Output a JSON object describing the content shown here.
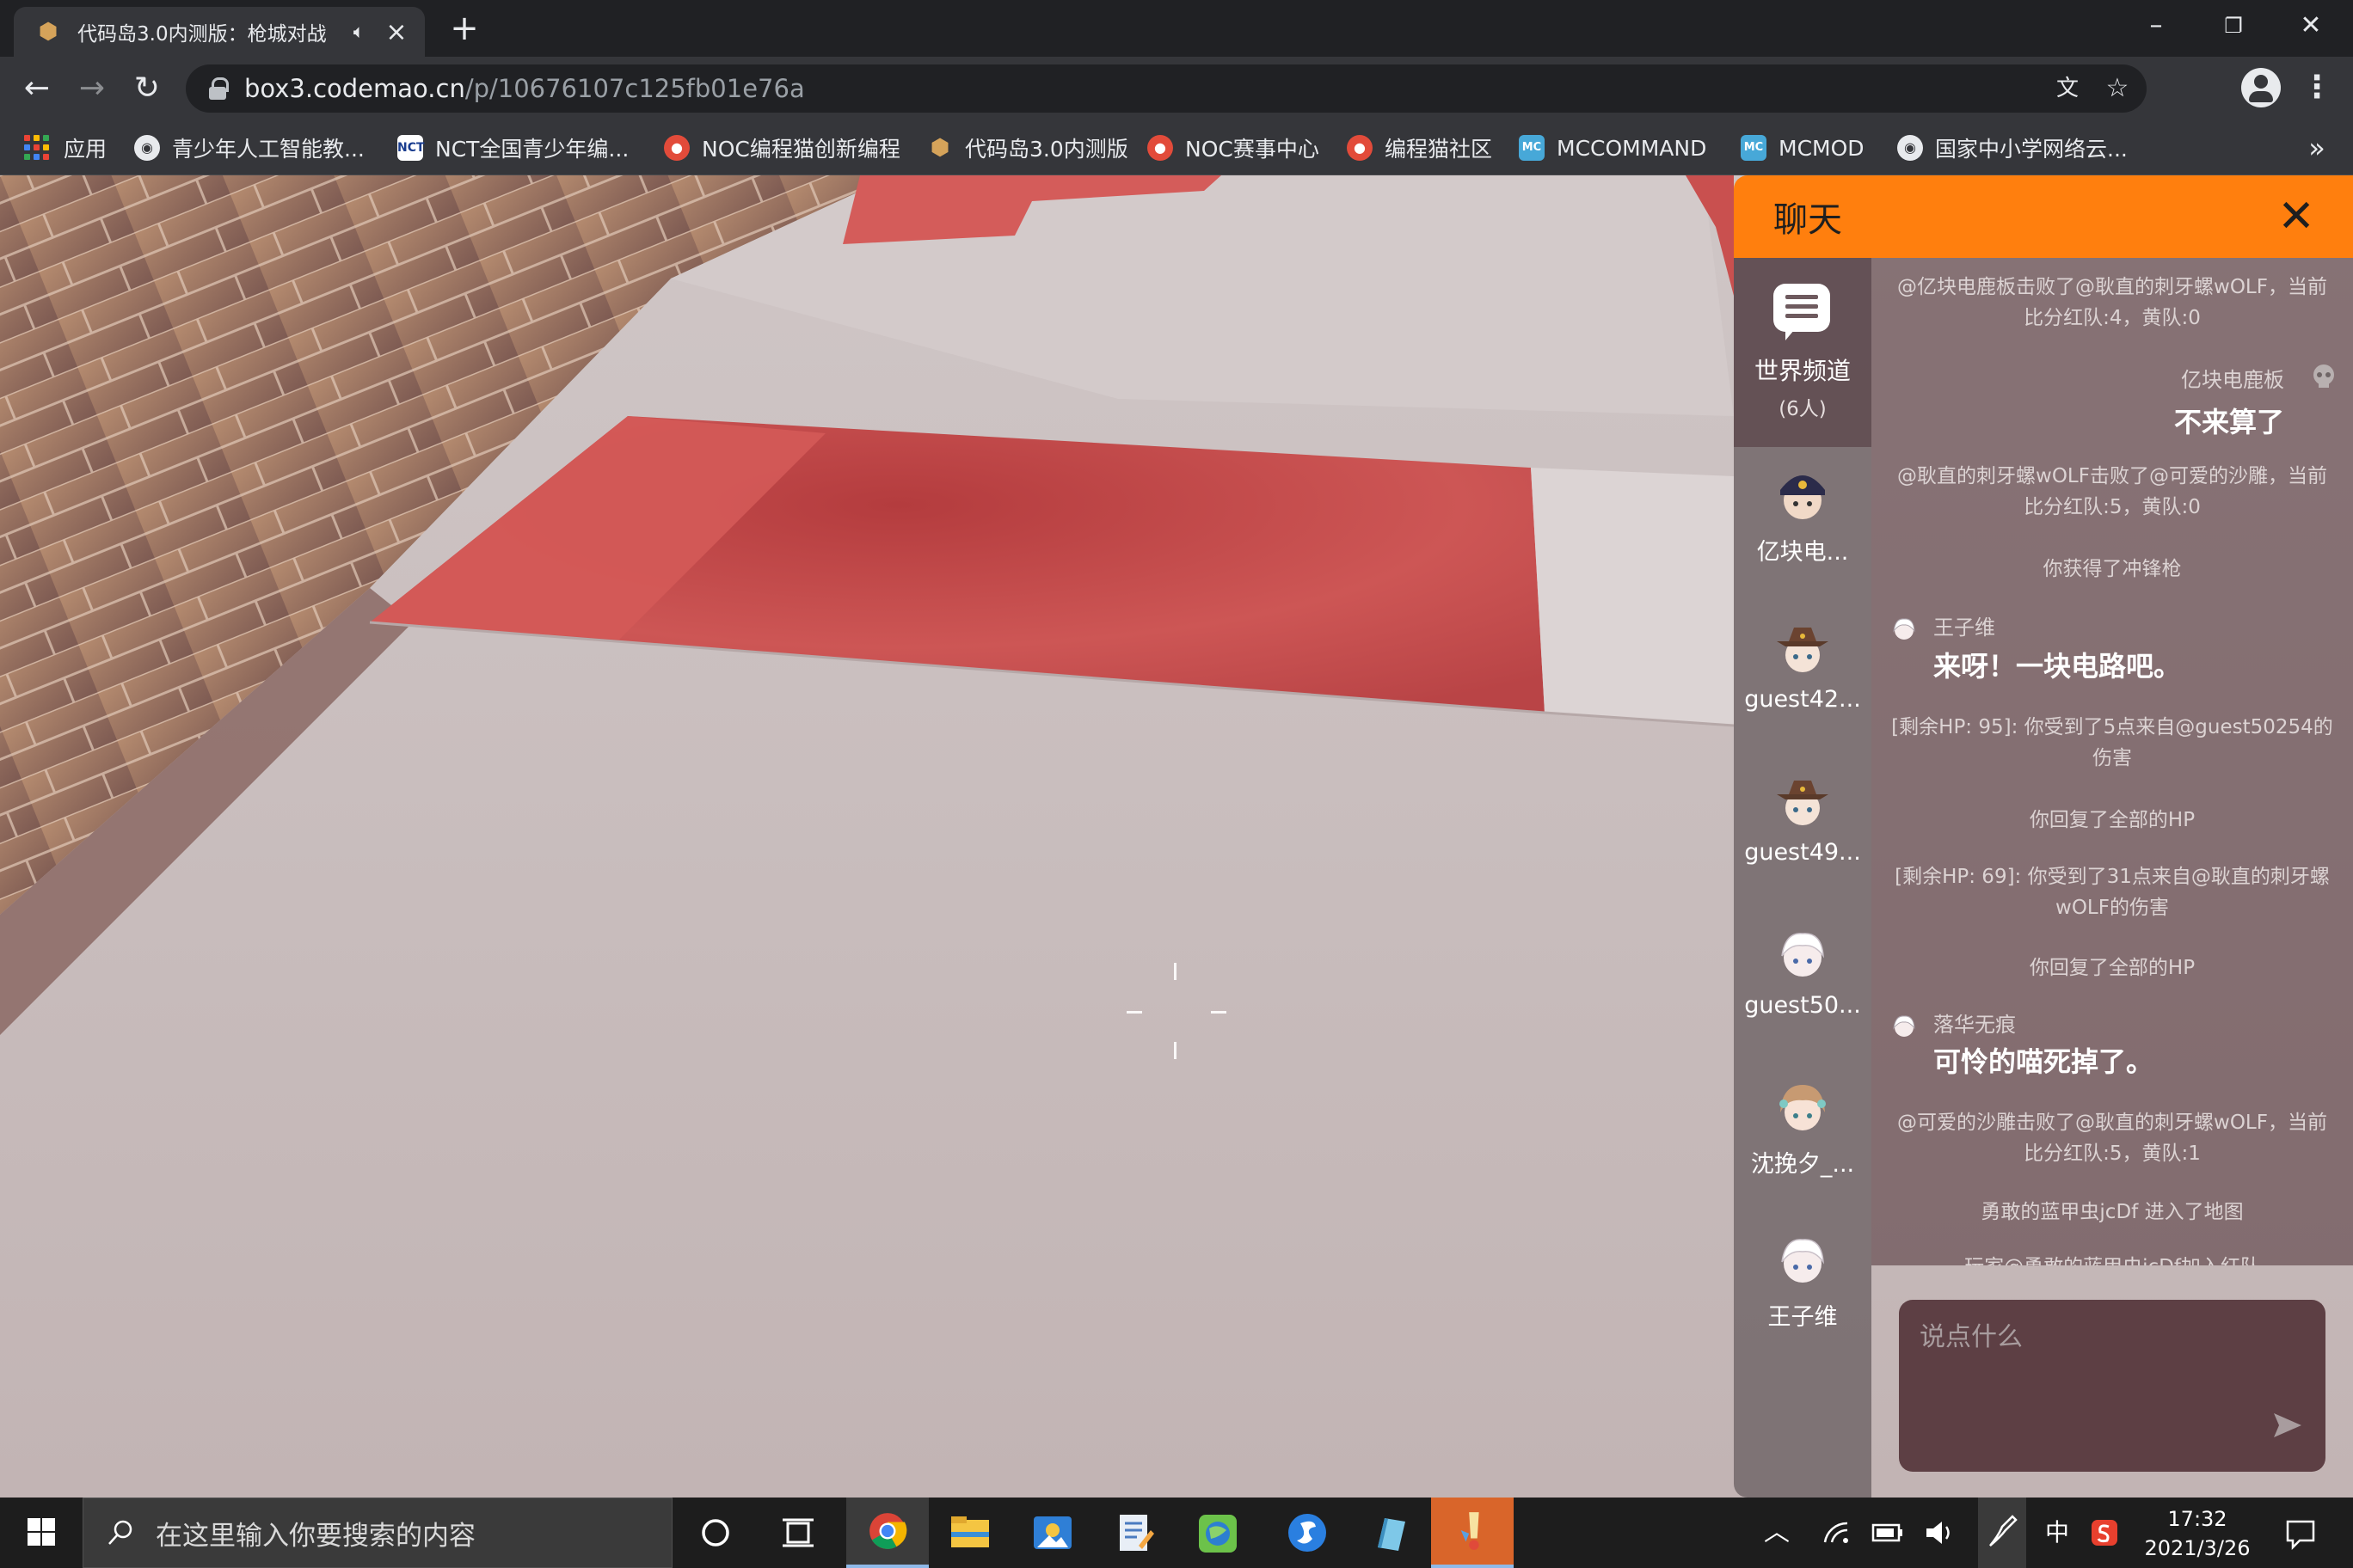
{
  "browser": {
    "tab_title": "代码岛3.0内测版：枪城对战",
    "tab_audio_icon": "speaker-icon",
    "url_host": "box3.codemao.cn",
    "url_path": "/p/10676107c125fb01e76a",
    "bookmarks": [
      {
        "label": "应用",
        "icon": "apps-grid-icon"
      },
      {
        "label": "青少年人工智能教...",
        "icon": "globe-icon"
      },
      {
        "label": "NCT全国青少年编...",
        "icon": "nct-icon"
      },
      {
        "label": "NOC编程猫创新编程",
        "icon": "codemao-icon"
      },
      {
        "label": "代码岛3.0内测版",
        "icon": "box3-icon"
      },
      {
        "label": "NOC赛事中心",
        "icon": "codemao-icon"
      },
      {
        "label": "编程猫社区",
        "icon": "codemao-icon"
      },
      {
        "label": "MCCOMMAND",
        "icon": "mc-icon"
      },
      {
        "label": "MCMOD",
        "icon": "mc-icon"
      },
      {
        "label": "国家中小学网络云...",
        "icon": "globe-icon"
      }
    ],
    "more_bookmarks": "»"
  },
  "chat": {
    "title": "聊天",
    "world_channel": {
      "label": "世界频道",
      "count": "(6人)"
    },
    "members": [
      {
        "name": "亿块电...",
        "avatar": "avatar-hat-dark"
      },
      {
        "name": "guest42...",
        "avatar": "avatar-hat-brown"
      },
      {
        "name": "guest49...",
        "avatar": "avatar-hat-brown"
      },
      {
        "name": "guest50...",
        "avatar": "avatar-white-hair"
      },
      {
        "name": "沈挽夕_...",
        "avatar": "avatar-brown-hair"
      },
      {
        "name": "王子维",
        "avatar": "avatar-white-hair"
      }
    ],
    "messages": {
      "m1": "@亿块电鹿板击败了@耿直的刺牙螺wOLF，当前比分红队:4，黄队:0",
      "m2_name": "亿块电鹿板",
      "m2_text": "不来算了",
      "m3": "@耿直的刺牙螺wOLF击败了@可爱的沙雕，当前比分红队:5，黄队:0",
      "m4": "你获得了冲锋枪",
      "m5_name": "王子维",
      "m5_text": "来呀！一块电路吧。",
      "m6": "[剩余HP: 95]: 你受到了5点来自@guest50254的伤害",
      "m7": "你回复了全部的HP",
      "m8": "[剩余HP: 69]: 你受到了31点来自@耿直的刺牙螺wOLF的伤害",
      "m9": "你回复了全部的HP",
      "m10_name": "落华无痕",
      "m10_text": "可怜的喵死掉了。",
      "m11": "@可爱的沙雕击败了@耿直的刺牙螺wOLF，当前比分红队:5，黄队:1",
      "m12": "勇敢的蓝甲虫jcDf 进入了地图",
      "m13": "玩家@勇敢的蓝甲虫jcDf加入红队"
    },
    "input_placeholder": "说点什么"
  },
  "taskbar": {
    "search_placeholder": "在这里输入你要搜索的内容",
    "ime": "中",
    "time": "17:32",
    "date": "2021/3/26"
  },
  "colors": {
    "chat_header": "#ff7f0e",
    "tabbar": "#202124",
    "toolbar": "#35363a",
    "floor_red": "#c9504f",
    "floor_white": "#c8bdbd"
  }
}
